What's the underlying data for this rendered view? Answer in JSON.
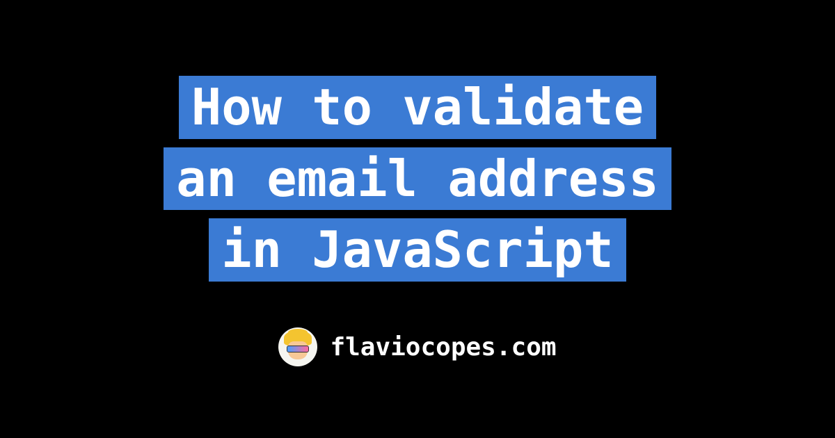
{
  "title": {
    "line1": "How to validate",
    "line2": "an email address",
    "line3": "in JavaScript"
  },
  "footer": {
    "site_name": "flaviocopes.com"
  }
}
